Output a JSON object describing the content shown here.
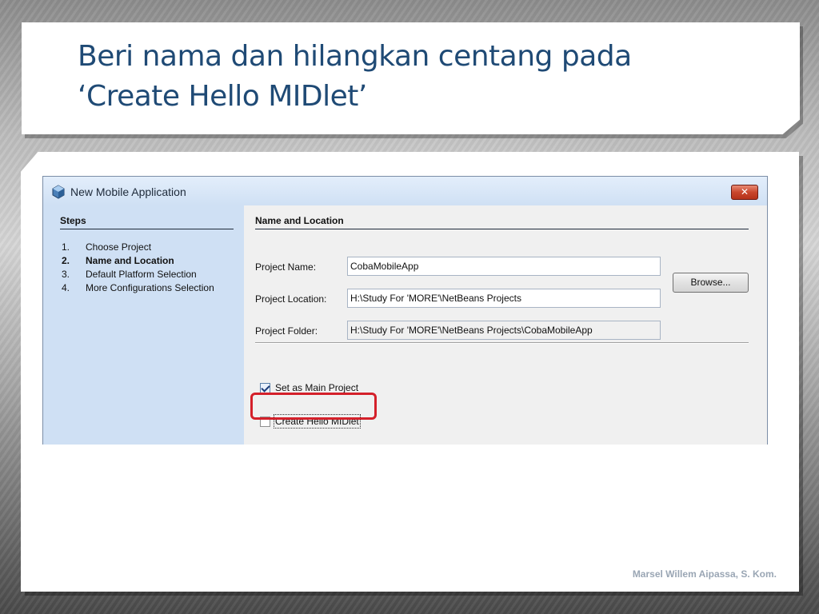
{
  "slide": {
    "title_line1": "Beri nama dan hilangkan centang pada",
    "title_line2": "‘Create Hello MIDlet’",
    "footer": "Marsel Willem Aipassa, S. Kom."
  },
  "dialog": {
    "title": "New Mobile Application",
    "close_symbol": "✕",
    "icon": "netbeans-cube-icon",
    "steps": {
      "heading": "Steps",
      "items": [
        {
          "num": "1.",
          "label": "Choose Project",
          "current": false
        },
        {
          "num": "2.",
          "label": "Name and Location",
          "current": true
        },
        {
          "num": "3.",
          "label": "Default Platform Selection",
          "current": false
        },
        {
          "num": "4.",
          "label": "More Configurations Selection",
          "current": false
        }
      ]
    },
    "panel": {
      "heading": "Name and Location",
      "project_name_label": "Project Name:",
      "project_name_value": "CobaMobileApp",
      "project_location_label": "Project Location:",
      "project_location_value": "H:\\Study For 'MORE'\\NetBeans Projects",
      "browse_label": "Browse...",
      "project_folder_label": "Project Folder:",
      "project_folder_value": "H:\\Study For 'MORE'\\NetBeans Projects\\CobaMobileApp",
      "set_main_label": "Set as Main Project",
      "set_main_checked": true,
      "hello_midlet_label": "Create Hello MIDlet",
      "hello_midlet_checked": false
    },
    "colors": {
      "highlight": "#d4202a",
      "title_text": "#1f4a75"
    }
  }
}
